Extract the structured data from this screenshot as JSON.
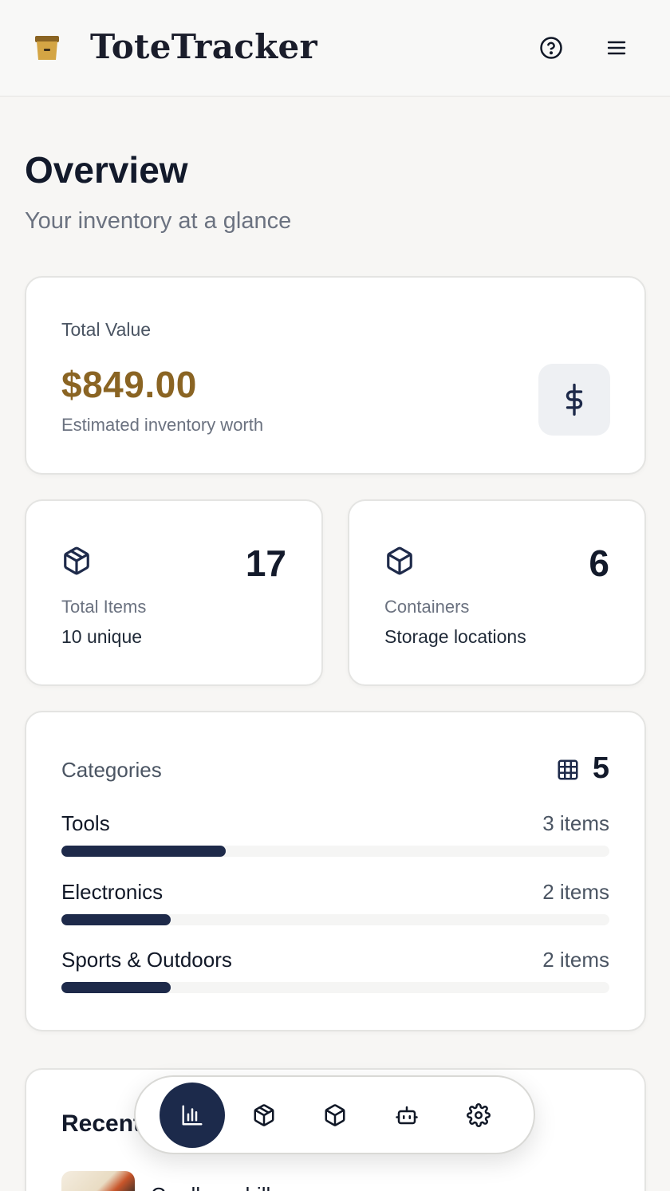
{
  "header": {
    "app_title": "ToteTracker",
    "logo_icon": "tote-box-icon",
    "help_icon": "help-circle-icon",
    "menu_icon": "hamburger-menu-icon"
  },
  "page": {
    "title": "Overview",
    "subtitle": "Your inventory at a glance"
  },
  "total_value": {
    "label": "Total Value",
    "amount": "$849.00",
    "note": "Estimated inventory worth",
    "icon": "dollar-icon"
  },
  "stats": {
    "items": {
      "count": "17",
      "label": "Total Items",
      "sub": "10 unique",
      "icon": "package-icon"
    },
    "containers": {
      "count": "6",
      "label": "Containers",
      "sub": "Storage locations",
      "icon": "box-icon"
    }
  },
  "categories": {
    "title": "Categories",
    "count": "5",
    "icon": "grid-icon",
    "rows": [
      {
        "name": "Tools",
        "qty": "3 items",
        "fraction": 0.3
      },
      {
        "name": "Electronics",
        "qty": "2 items",
        "fraction": 0.2
      },
      {
        "name": "Sports & Outdoors",
        "qty": "2 items",
        "fraction": 0.2
      }
    ]
  },
  "recent": {
    "title": "Recent",
    "first_item": "Cordless drill"
  },
  "nav": {
    "items": [
      "bar-chart-icon",
      "package-icon",
      "box-icon",
      "robot-icon",
      "settings-gear-icon"
    ],
    "active": "bar-chart-icon"
  },
  "colors": {
    "accent": "#8a6423",
    "navy": "#1c2a4b",
    "background": "#f7f6f4"
  }
}
